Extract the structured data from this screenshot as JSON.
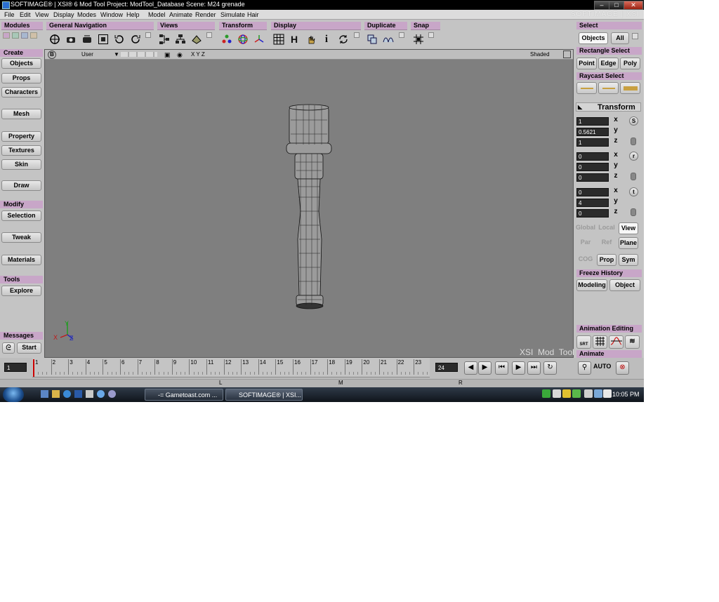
{
  "window": {
    "title": "SOFTIMAGE® | XSI® 6 Mod Tool Project: ModTool_Database    Scene: M24 grenade",
    "brand": "SOFTIMAGE | XSI",
    "controls": [
      "minimize",
      "maximize",
      "close"
    ]
  },
  "menu": [
    "File",
    "Edit",
    "View",
    "Display",
    "Modes",
    "Window",
    "Help",
    "Model",
    "Animate",
    "Render",
    "Simulate",
    "Hair"
  ],
  "toolbar": {
    "modules": "Modules",
    "general_navigation": "General Navigation",
    "views": "Views",
    "transform": "Transform",
    "display": "Display",
    "duplicate": "Duplicate",
    "snap": "Snap"
  },
  "left_panel": {
    "create": "Create",
    "create_items": [
      "Objects",
      "Props",
      "Characters",
      "Mesh",
      "Property",
      "Textures",
      "Skin",
      "Draw"
    ],
    "modify": "Modify",
    "modify_items": [
      "Selection",
      "Tweak",
      "Materials"
    ],
    "tools": "Tools",
    "tools_items": [
      "Explore"
    ],
    "messages": "Messages",
    "start": "Start"
  },
  "viewport": {
    "letter": "B",
    "camera": "User",
    "axes": "X Y Z",
    "mode": "Shaded",
    "watermark": "XSI  Mod  Tool",
    "axis_y": "Y",
    "axis_x": "X",
    "axis_z": "Z"
  },
  "right_panel": {
    "select": "Select",
    "objects": "Objects",
    "all": "All",
    "rectangle_select": "Rectangle Select",
    "point": "Point",
    "edge": "Edge",
    "poly": "Poly",
    "raycast_select": "Raycast Select",
    "transform": "Transform",
    "scale": [
      "1",
      "0.5621",
      "1"
    ],
    "rotate": [
      "0",
      "0",
      "0"
    ],
    "translate": [
      "0",
      "4",
      "0"
    ],
    "axes": [
      "x",
      "y",
      "z"
    ],
    "s": "S",
    "r": "r",
    "t": "t",
    "global": "Global",
    "local": "Local",
    "view": "View",
    "par": "Par",
    "ref": "Ref",
    "plane": "Plane",
    "cog": "COG",
    "prop": "Prop",
    "sym": "Sym",
    "freeze_history": "Freeze History",
    "modeling": "Modeling",
    "object": "Object",
    "animation_editing": "Animation Editing",
    "srt": "SRT",
    "animate": "Animate",
    "auto": "AUTO"
  },
  "timeline": {
    "current_frame": "1",
    "ticks": [
      "1",
      "2",
      "3",
      "4",
      "5",
      "6",
      "7",
      "8",
      "9",
      "10",
      "11",
      "12",
      "13",
      "14",
      "15",
      "16",
      "17",
      "18",
      "19",
      "20",
      "21",
      "22",
      "23"
    ],
    "end_frame": "24",
    "markers": [
      "L",
      "M",
      "R"
    ]
  },
  "taskbar": {
    "tasks": [
      "-= Gametoast.com ...",
      "SOFTIMAGE® | XSI..."
    ],
    "clock": "10:05 PM"
  },
  "colors": {
    "section_header": "#c8a6c8",
    "viewport_bg": "#7f7f7f",
    "panel_bg": "#c0bfc0",
    "playhead": "#cc0000"
  }
}
